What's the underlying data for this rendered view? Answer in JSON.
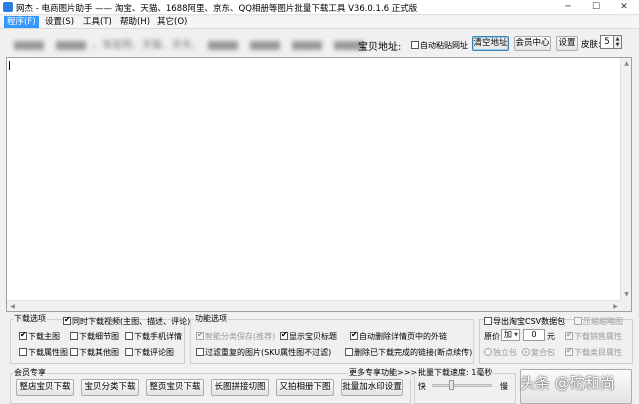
{
  "window": {
    "title": "网杰 - 电商图片助手 —— 淘宝、天猫、1688阿里、京东、QQ相册等图片批量下载工具 V36.0.1.6 正式版",
    "controls": [
      "─",
      "☐",
      "✕"
    ]
  },
  "menu": [
    "程序(F)",
    "设置(S)",
    "工具(T)",
    "帮助(H)",
    "其它(O)"
  ],
  "toolbar": {
    "blurred_text": "、淘宝网、天猫、京东、",
    "address_label": "宝贝地址:",
    "auto_paste_label": "自动粘贴网址",
    "auto_paste_checked": false,
    "clear_button": "清空地址",
    "member_center_button": "会员中心",
    "settings_button": "设置",
    "skin_label": "皮肤:",
    "skin_value": "5"
  },
  "download_options": {
    "title": "下载选项",
    "video": {
      "label": "同时下载视频(主图、描述、评论)",
      "checked": true
    },
    "main_image": {
      "label": "下载主图",
      "checked": true
    },
    "detail_image": {
      "label": "下载细节图",
      "checked": false
    },
    "mobile_detail": {
      "label": "下载手机详情",
      "checked": false
    },
    "attr_image": {
      "label": "下载属性图",
      "checked": false
    },
    "other_image": {
      "label": "下载其他图",
      "checked": false
    },
    "review_image": {
      "label": "下载评论图",
      "checked": false
    }
  },
  "function_options": {
    "title": "功能选项",
    "smart_category": {
      "label": "智能分类保存(推荐)",
      "checked": true,
      "disabled": true
    },
    "show_title": {
      "label": "显示宝贝标题",
      "checked": true
    },
    "auto_delete_links": {
      "label": "自动删除详情页中的外链",
      "checked": true
    },
    "filter_duplicates": {
      "label": "过滤重复的图片(SKU属性图不过滤)",
      "checked": false
    },
    "delete_finished": {
      "label": "删除已下载完成的链接(断点续传)",
      "checked": false
    }
  },
  "csv_panel": {
    "export_csv": {
      "label": "导出淘宝CSV数据包",
      "checked": false
    },
    "compress_thumb": {
      "label": "压缩缩略图",
      "checked": false,
      "disabled": true
    },
    "price_label": "原价",
    "price_op": "加",
    "price_value": "0",
    "price_unit": "元",
    "sales_attr": {
      "label": "下载销售属性",
      "checked": true,
      "disabled": true
    },
    "standalone": {
      "label": "独立包",
      "selected": false
    },
    "combined": {
      "label": "复合包",
      "selected": true
    },
    "category_attr": {
      "label": "下载类目属性",
      "checked": true,
      "disabled": true
    }
  },
  "member": {
    "title": "会员专享",
    "more": "更多专享功能>>>",
    "buttons": [
      "整店宝贝下载",
      "宝贝分类下载",
      "整页宝贝下载",
      "长图拼接切图",
      "又拍相册下图",
      "批量加水印设置"
    ]
  },
  "batch_speed": {
    "title": "批量下载速度: 1毫秒",
    "fast": "快",
    "slow": "慢",
    "level": 0.3
  },
  "watermark": "头条 @砣和尚"
}
